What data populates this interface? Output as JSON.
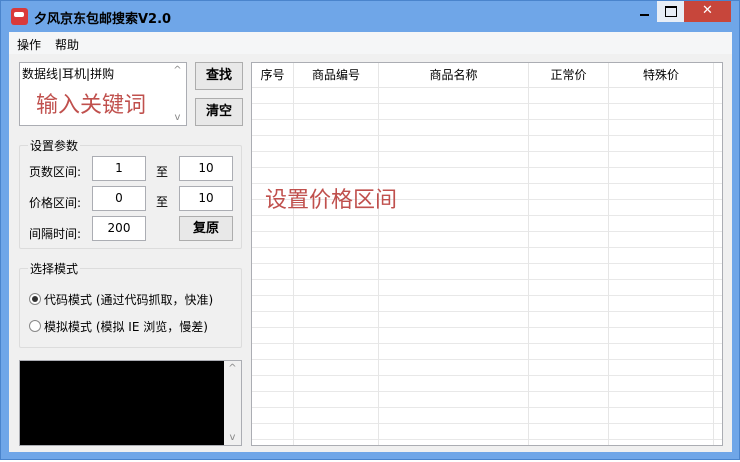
{
  "window": {
    "title": "夕风京东包邮搜索V2.0",
    "close_glyph": "✕"
  },
  "menu": [
    "操作",
    "帮助"
  ],
  "keywords": {
    "value": "数据线|耳机|拼购",
    "hint": "输入关键词"
  },
  "buttons": {
    "search": "查找",
    "clear": "清空",
    "reset": "复原"
  },
  "params": {
    "group_label": "设置参数",
    "page_label": "页数区间:",
    "page_from": "1",
    "page_to": "10",
    "to": "至",
    "price_label": "价格区间:",
    "price_from": "0",
    "price_to": "10",
    "interval_label": "间隔时间:",
    "interval": "200"
  },
  "mode": {
    "group_label": "选择模式",
    "options": [
      {
        "label": "代码模式 (通过代码抓取，快准)",
        "selected": true
      },
      {
        "label": "模拟模式 (模拟 IE 浏览，慢差)",
        "selected": false
      }
    ]
  },
  "table": {
    "columns": [
      "序号",
      "商品编号",
      "商品名称",
      "正常价",
      "特殊价"
    ]
  },
  "overlay": "设置价格区间",
  "scroll": {
    "up": "^",
    "down": "v"
  }
}
